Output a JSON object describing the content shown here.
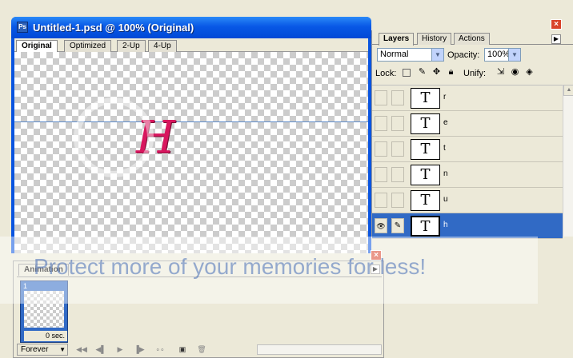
{
  "document": {
    "title": "Untitled-1.psd @ 100% (Original)",
    "icon": "ps-file-icon",
    "tabs": [
      {
        "label": "Original",
        "active": true
      },
      {
        "label": "Optimized",
        "active": false
      },
      {
        "label": "2-Up",
        "active": false
      },
      {
        "label": "4-Up",
        "active": false
      }
    ],
    "canvas_glyph": "H",
    "glyph_color": "#d8165e"
  },
  "layers_palette": {
    "close_icon": "close-icon",
    "tabs": [
      {
        "label": "Layers",
        "active": true
      },
      {
        "label": "History",
        "active": false
      },
      {
        "label": "Actions",
        "active": false
      }
    ],
    "blend_mode": "Normal",
    "opacity_label": "Opacity:",
    "opacity_value": "100%",
    "lock_label": "Lock:",
    "unify_label": "Unify:",
    "layers": [
      {
        "name": "r",
        "thumb": "T",
        "visible": false,
        "selected": false
      },
      {
        "name": "e",
        "thumb": "T",
        "visible": false,
        "selected": false
      },
      {
        "name": "t",
        "thumb": "T",
        "visible": false,
        "selected": false
      },
      {
        "name": "n",
        "thumb": "T",
        "visible": false,
        "selected": false
      },
      {
        "name": "u",
        "thumb": "T",
        "visible": false,
        "selected": false
      },
      {
        "name": "h",
        "thumb": "T",
        "visible": true,
        "selected": true
      }
    ],
    "selection_color": "#316ac5"
  },
  "animation_palette": {
    "tab_label": "Animation",
    "frames": [
      {
        "number": "1",
        "delay": "0 sec."
      }
    ],
    "loop_option": "Forever"
  },
  "watermark": {
    "text": "Protect more of your memories for less!"
  }
}
